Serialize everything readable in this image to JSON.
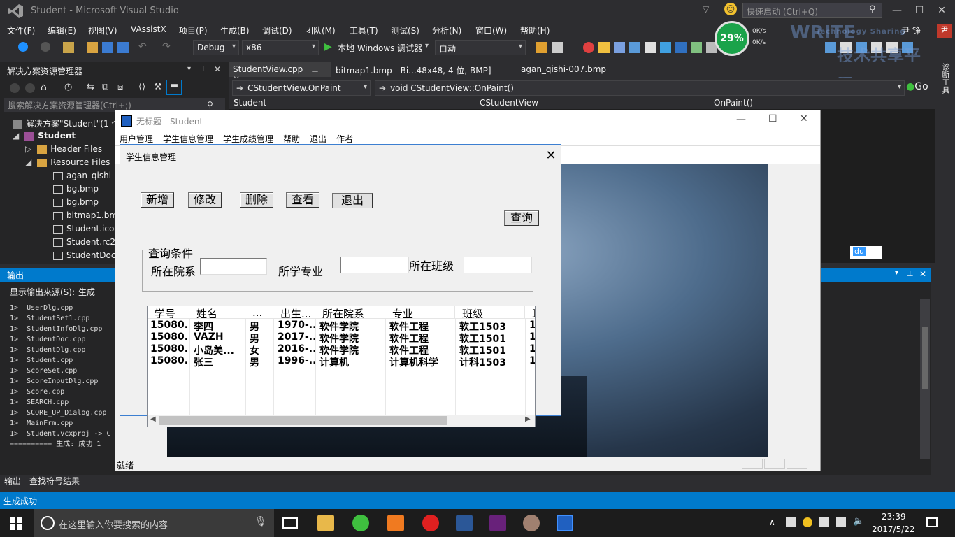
{
  "vs": {
    "title": "Student - Microsoft Visual Studio",
    "quick_launch": "快速启动 (Ctrl+Q)",
    "user": "尹 铮",
    "menu": [
      "文件(F)",
      "编辑(E)",
      "视图(V)",
      "VAssistX",
      "项目(P)",
      "生成(B)",
      "调试(D)",
      "团队(M)",
      "工具(T)",
      "测试(S)",
      "分析(N)",
      "窗口(W)",
      "帮助(H)"
    ],
    "toolbar": {
      "config": "Debug",
      "platform": "x86",
      "run_label": "本地 Windows 调试器",
      "mode": "自动"
    },
    "perf": {
      "percent": "29%",
      "up": "0K/s",
      "down": "0K/s"
    },
    "watermark": "技术共享平台",
    "watermark_sub": "Technology Sharing",
    "watermark_logo": "WRITE"
  },
  "solution": {
    "title": "解决方案资源管理器",
    "search": "搜索解决方案资源管理器(Ctrl+;)",
    "items": [
      {
        "label": "解决方案\"Student\"(1 个项目)"
      },
      {
        "label": "Student"
      },
      {
        "label": "Header Files"
      },
      {
        "label": "Resource Files"
      },
      {
        "label": "agan_qishi-007.bmp"
      },
      {
        "label": "bg.bmp"
      },
      {
        "label": "bg.bmp"
      },
      {
        "label": "bitmap1.bmp"
      },
      {
        "label": "Student.ico"
      },
      {
        "label": "Student.rc2"
      },
      {
        "label": "StudentDoc.ico"
      }
    ]
  },
  "editor": {
    "tabs": [
      "StudentView.cpp",
      "bitmap1.bmp - Bi...48x48, 4 位, BMP]",
      "agan_qishi-007.bmp"
    ],
    "nav_class": "CStudentView.OnPaint",
    "nav_method": "void CStudentView::OnPaint()",
    "go": "Go",
    "scope_project": "Student",
    "scope_class": "CStudentView",
    "scope_member": "OnPaint()",
    "zoom_combo": "du"
  },
  "output": {
    "title": "输出",
    "source_label": "显示输出来源(S):",
    "source_value": "生成",
    "lines": [
      "1>  UserDlg.cpp",
      "1>  StudentSet1.cpp",
      "1>  StudentInfoDlg.cpp",
      "1>  StudentDoc.cpp",
      "1>  StudentDlg.cpp",
      "1>  Student.cpp",
      "1>  ScoreSet.cpp",
      "1>  ScoreInputDlg.cpp",
      "1>  Score.cpp",
      "1>  SEARCH.cpp",
      "1>  SCORE_UP_Dialog.cpp",
      "1>  MainFrm.cpp",
      "1>  Student.vcxproj -> C",
      "========== 生成: 成功 1"
    ],
    "tabs": [
      "输出",
      "查找符号结果"
    ]
  },
  "status": {
    "text": "生成成功"
  },
  "right_sidebar": {
    "label": "诊断工具"
  },
  "app": {
    "title": "无标题 - Student",
    "menu": [
      "用户管理",
      "学生信息管理",
      "学生成绩管理",
      "帮助",
      "退出",
      "作者"
    ],
    "status": "就绪"
  },
  "dialog": {
    "title": "学生信息管理",
    "buttons": {
      "add": "新增",
      "edit": "修改",
      "delete": "删除",
      "view": "查看",
      "exit": "退出",
      "query": "查询"
    },
    "group_label": "查询条件",
    "labels": {
      "dept": "所在院系",
      "major": "所学专业",
      "class": "所在班级"
    },
    "table": {
      "headers": [
        "学号",
        "姓名",
        "...",
        "出生...",
        "所在院系",
        "专业",
        "班级",
        "耳"
      ],
      "rows": [
        [
          "15080...",
          "李四",
          "男",
          "1970-...",
          "软件学院",
          "软件工程",
          "软工1503",
          "1"
        ],
        [
          "15080...",
          "VAZH",
          "男",
          "2017-...",
          "软件学院",
          "软件工程",
          "软工1501",
          "1"
        ],
        [
          "15080...",
          "小岛美...",
          "女",
          "2016-...",
          "软件学院",
          "软件工程",
          "软工1501",
          "1"
        ],
        [
          "15080...",
          "张三",
          "男",
          "1996-...",
          "计算机",
          "计算机科学",
          "计科1503",
          "1"
        ]
      ]
    }
  },
  "taskbar": {
    "search": "在这里输入你要搜索的内容",
    "time": "23:39",
    "date": "2017/5/22"
  }
}
